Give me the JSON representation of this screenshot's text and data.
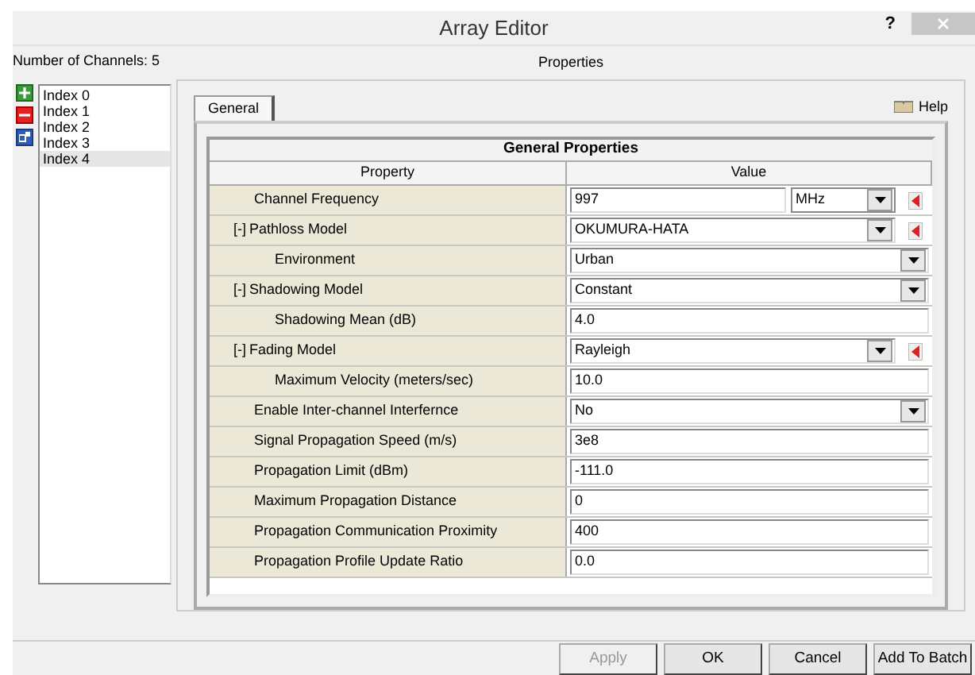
{
  "window": {
    "title": "Array Editor",
    "help": "?"
  },
  "channel_count": "Number of Channels: 5",
  "channels": [
    {
      "label": "Index 0",
      "selected": false
    },
    {
      "label": "Index 1",
      "selected": false
    },
    {
      "label": "Index 2",
      "selected": false
    },
    {
      "label": "Index 3",
      "selected": false
    },
    {
      "label": "Index 4",
      "selected": true
    }
  ],
  "properties_title": "Properties",
  "tabs": [
    {
      "label": "General",
      "selected": true
    }
  ],
  "help_link": "Help",
  "table": {
    "title": "General Properties",
    "columns": [
      "Property",
      "Value"
    ],
    "rows": [
      {
        "name": "Channel Frequency",
        "kind": "text",
        "value": "997",
        "unit": "MHz",
        "reset": true
      },
      {
        "name": "Pathloss Model",
        "toggle": "[-]",
        "kind": "select",
        "value": "OKUMURA-HATA",
        "reset": true,
        "children": [
          {
            "name": "Environment",
            "kind": "select",
            "value": "Urban",
            "reset": false
          }
        ]
      },
      {
        "name": "Shadowing Model",
        "toggle": "[-]",
        "kind": "select",
        "value": "Constant",
        "reset": false,
        "children": [
          {
            "name": "Shadowing Mean (dB)",
            "kind": "text",
            "value": "4.0",
            "reset": false
          }
        ]
      },
      {
        "name": "Fading Model",
        "toggle": "[-]",
        "kind": "select",
        "value": "Rayleigh",
        "reset": true,
        "children": [
          {
            "name": "Maximum Velocity (meters/sec)",
            "kind": "text",
            "value": "10.0",
            "reset": false
          }
        ]
      },
      {
        "name": "Enable Inter-channel Interfernce",
        "kind": "select",
        "value": "No",
        "reset": false
      },
      {
        "name": "Signal Propagation Speed (m/s)",
        "kind": "text",
        "value": "3e8",
        "reset": false
      },
      {
        "name": "Propagation Limit (dBm)",
        "kind": "text",
        "value": "-111.0",
        "reset": false
      },
      {
        "name": "Maximum Propagation Distance",
        "kind": "text",
        "value": "0",
        "reset": false
      },
      {
        "name": "Propagation Communication Proximity",
        "kind": "text",
        "value": "400",
        "reset": false
      },
      {
        "name": "Propagation Profile Update Ratio",
        "kind": "text",
        "value": "0.0",
        "reset": false
      }
    ]
  },
  "buttons": [
    {
      "label": "Apply",
      "disabled": true
    },
    {
      "label": "OK",
      "disabled": false
    },
    {
      "label": "Cancel",
      "disabled": false
    },
    {
      "label": "Add To Batch",
      "disabled": false
    }
  ]
}
